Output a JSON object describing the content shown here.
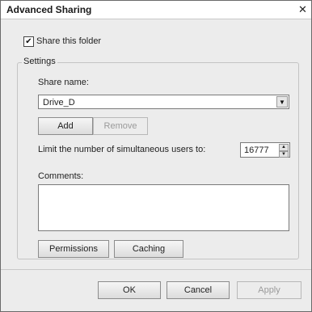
{
  "window": {
    "title": "Advanced Sharing",
    "close_glyph": "✕"
  },
  "share_folder": {
    "checked": true,
    "check_glyph": "✔",
    "label": "Share this folder"
  },
  "settings": {
    "legend": "Settings",
    "share_name_label": "Share name:",
    "share_name_value": "Drive_D",
    "add_label": "Add",
    "remove_label": "Remove",
    "limit_label": "Limit the number of simultaneous users to:",
    "limit_value": "16777",
    "comments_label": "Comments:",
    "comments_value": "",
    "permissions_label": "Permissions",
    "caching_label": "Caching"
  },
  "footer": {
    "ok_label": "OK",
    "cancel_label": "Cancel",
    "apply_label": "Apply"
  },
  "icons": {
    "dropdown": "chevron-down-icon",
    "spin_up": "arrow-up-icon",
    "spin_down": "arrow-down-icon"
  }
}
